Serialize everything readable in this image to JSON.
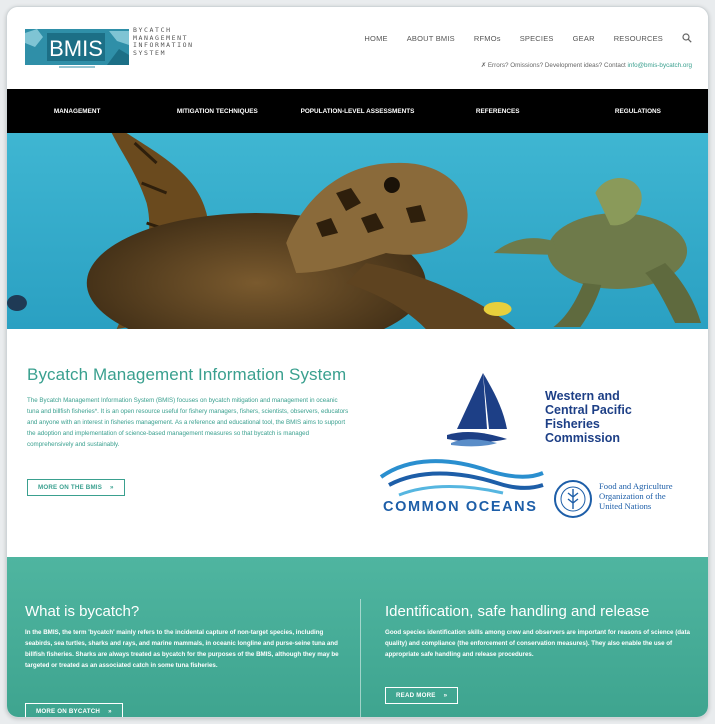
{
  "header": {
    "logo_text": "BMIS",
    "tagline": [
      "BYCATCH",
      "MANAGEMENT",
      "INFORMATION",
      "SYSTEM"
    ],
    "nav": [
      "HOME",
      "ABOUT BMIS",
      "RFMOs",
      "SPECIES",
      "GEAR",
      "RESOURCES"
    ],
    "contact_prefix": "✗ Errors? Omissions? Development ideas? Contact",
    "contact_email": "info@bmis-bycatch.org"
  },
  "mainnav": [
    "MANAGEMENT",
    "MITIGATION TECHNIQUES",
    "POPULATION-LEVEL ASSESSMENTS",
    "REFERENCES",
    "REGULATIONS"
  ],
  "intro": {
    "title": "Bycatch Management Information System",
    "description": "The Bycatch Management Information System (BMIS) focuses on bycatch mitigation and management in oceanic tuna and billfish fisheries*. It is an open resource useful for fishery managers, fishers, scientists, observers, educators and anyone with an interest in fisheries management. As a reference and educational tool, the BMIS aims to support the adoption and implementation of science-based management measures so that bycatch is managed comprehensively and sustainably.",
    "button": "MORE ON THE BMIS",
    "partners": {
      "wcpfc": [
        "Western and",
        "Central Pacific",
        "Fisheries",
        "Commission"
      ],
      "common_oceans": "COMMON OCEANS",
      "fao": [
        "Food and Agriculture",
        "Organization of the",
        "United Nations"
      ]
    }
  },
  "band": {
    "left": {
      "title": "What is bycatch?",
      "text": "In the BMIS, the term 'bycatch' mainly refers to the incidental capture of non-target species, including seabirds, sea turtles, sharks and rays, and marine mammals, in oceanic longline and purse-seine tuna and billfish fisheries. Sharks are always treated as bycatch for the purposes of the BMIS, although they may be targeted or treated as an associated catch in some tuna fisheries.",
      "button": "MORE ON BYCATCH"
    },
    "right": {
      "title": "Identification, safe handling and release",
      "text": "Good species identification skills among crew and observers are important for reasons of science (data quality) and compliance (the enforcement of conservation measures). They also enable the use of appropriate safe handling and release procedures.",
      "button": "READ MORE"
    }
  },
  "colors": {
    "teal": "#3aa08f",
    "navy": "#1d3f86",
    "blue": "#1d5ea8",
    "black_nav": "#000000"
  },
  "icons": [
    "search-icon",
    "chevron-right-icon",
    "bmis-logo",
    "wcpfc-logo",
    "common-oceans-logo",
    "fao-logo"
  ]
}
